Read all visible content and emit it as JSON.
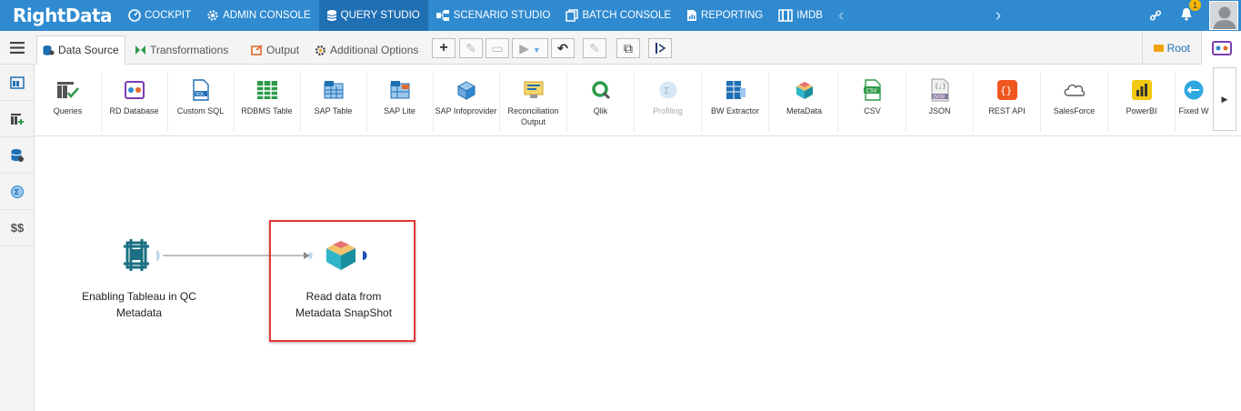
{
  "app": {
    "logo_text": "RightData"
  },
  "topnav": {
    "items": [
      {
        "label": "COCKPIT",
        "icon": "cockpit-icon"
      },
      {
        "label": "ADMIN CONSOLE",
        "icon": "gear-icon"
      },
      {
        "label": "QUERY STUDIO",
        "icon": "database-icon",
        "active": true
      },
      {
        "label": "SCENARIO STUDIO",
        "icon": "scenario-icon"
      },
      {
        "label": "BATCH CONSOLE",
        "icon": "batch-icon"
      },
      {
        "label": "REPORTING",
        "icon": "report-icon"
      },
      {
        "label": "IMDB",
        "icon": "imdb-icon"
      }
    ],
    "notification_count": "1"
  },
  "tabs": {
    "items": [
      {
        "label": "Data Source",
        "active": true
      },
      {
        "label": "Transformations"
      },
      {
        "label": "Output"
      },
      {
        "label": "Additional Options"
      }
    ],
    "root_label": "Root"
  },
  "palette": {
    "items": [
      {
        "label": "Queries"
      },
      {
        "label": "RD Database"
      },
      {
        "label": "Custom SQL"
      },
      {
        "label": "RDBMS Table"
      },
      {
        "label": "SAP Table"
      },
      {
        "label": "SAP Lite"
      },
      {
        "label": "SAP Infoprovider"
      },
      {
        "label": "Reconciliation Output"
      },
      {
        "label": "Qlik"
      },
      {
        "label": "Profiling",
        "disabled": true
      },
      {
        "label": "BW Extractor"
      },
      {
        "label": "MetaData"
      },
      {
        "label": "CSV"
      },
      {
        "label": "JSON"
      },
      {
        "label": "REST API"
      },
      {
        "label": "SalesForce"
      },
      {
        "label": "PowerBI"
      },
      {
        "label": "Fixed W"
      }
    ]
  },
  "sidebar": {
    "currency_label": "$$"
  },
  "canvas": {
    "nodes": [
      {
        "line1": "Enabling Tableau in QC",
        "line2": "Metadata"
      },
      {
        "line1": "Read data from",
        "line2": "Metadata SnapShot",
        "highlighted": true
      }
    ]
  },
  "colors": {
    "nav_bg": "#2f8ad0",
    "nav_active": "#1f6fb3",
    "highlight": "#e53935",
    "node_teal": "#1a7f8e"
  }
}
